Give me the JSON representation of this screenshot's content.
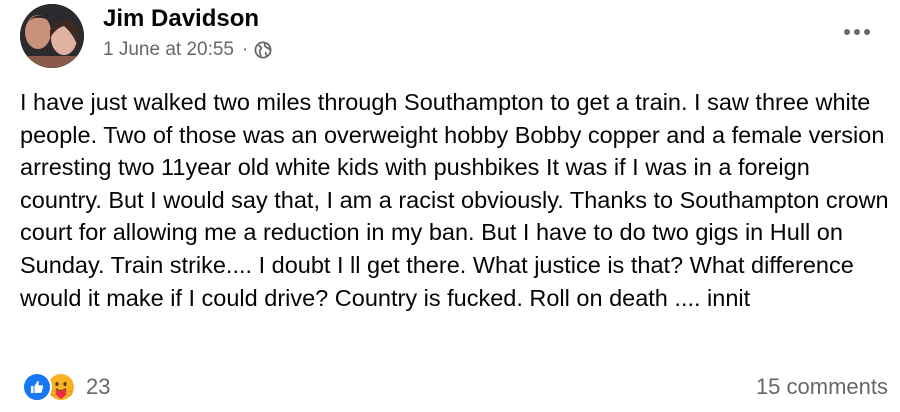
{
  "post": {
    "author": "Jim Davidson",
    "timestamp": "1 June at 20:55",
    "separator": "·",
    "audience_icon": "globe-icon",
    "more_icon": "more-horizontal-icon",
    "text": "I have just walked two miles through Southampton to get a train. I saw three white people.  Two of those was an overweight hobby Bobby copper and a female version arresting two 11year old white kids with pushbikes    It was if I was in a foreign country.  But I would say that, I am a racist obviously.  Thanks to Southampton crown court for allowing me a reduction in my ban. But I have to do two gigs in Hull on Sunday. Train strike.... I doubt I ll get there.  What justice is that? What difference would it make if I could drive? Country is fucked. Roll on death .... innit"
  },
  "footer": {
    "reaction_icons": [
      "like-icon",
      "care-icon"
    ],
    "reaction_count": "23",
    "comments": "15 comments"
  },
  "colors": {
    "text": "#050505",
    "secondary": "#65676b",
    "like": "#1877f2",
    "care": "#f7b125"
  }
}
